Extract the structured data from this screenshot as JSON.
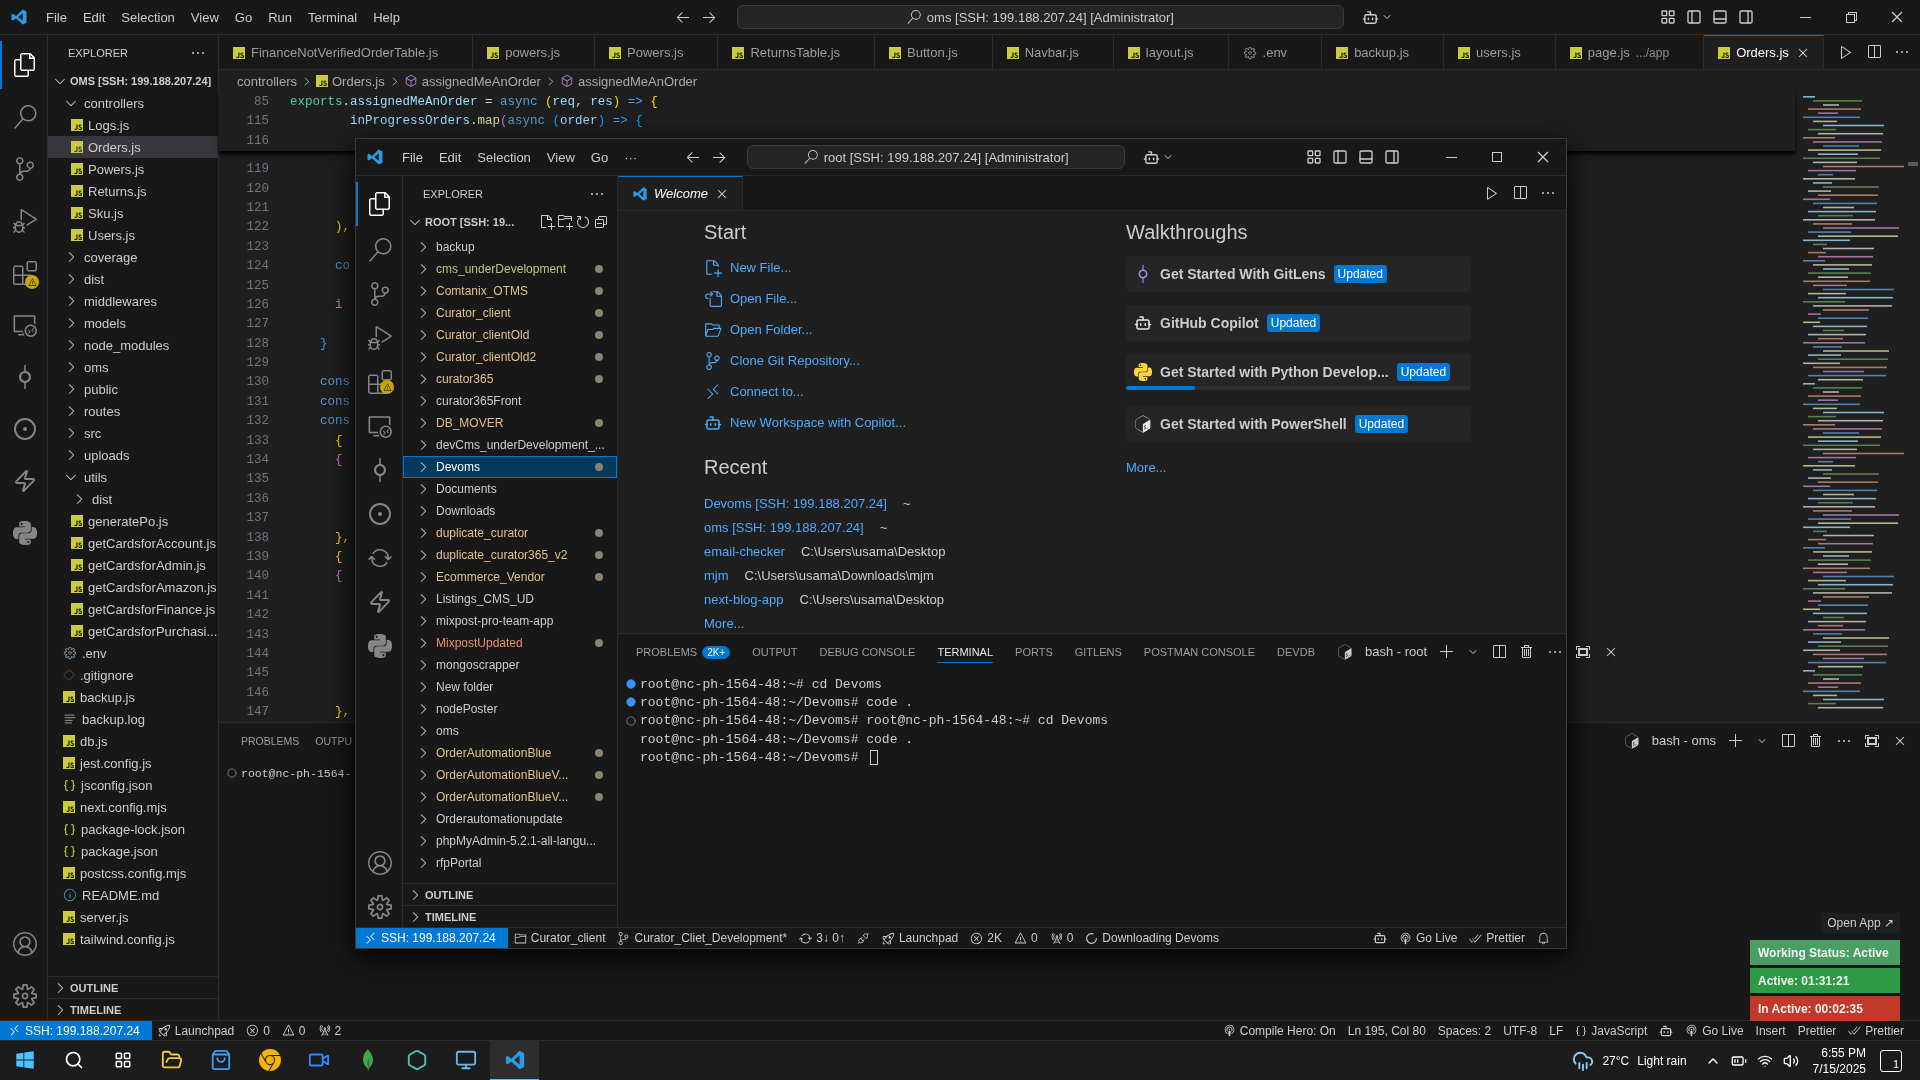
{
  "outer_window": {
    "menu": [
      "File",
      "Edit",
      "Selection",
      "View",
      "Go",
      "Run",
      "Terminal",
      "Help"
    ],
    "command_center": "oms [SSH: 199.188.207.24] [Administrator]",
    "explorer": {
      "title": "EXPLORER",
      "root": "OMS [SSH: 199.188.207.24]",
      "tree": [
        {
          "label": "controllers",
          "kind": "folder",
          "expanded": true,
          "selected": false,
          "children": [
            {
              "label": "Logs.js",
              "kind": "js",
              "selected": false
            },
            {
              "label": "Orders.js",
              "kind": "js",
              "selected": true
            },
            {
              "label": "Powers.js",
              "kind": "js",
              "selected": false
            },
            {
              "label": "Returns.js",
              "kind": "js",
              "selected": false
            },
            {
              "label": "Sku.js",
              "kind": "js",
              "selected": false
            },
            {
              "label": "Users.js",
              "kind": "js",
              "selected": false
            }
          ]
        },
        {
          "label": "coverage",
          "kind": "folder",
          "expanded": false,
          "selected": false
        },
        {
          "label": "dist",
          "kind": "folder",
          "expanded": false,
          "selected": false
        },
        {
          "label": "middlewares",
          "kind": "folder",
          "expanded": false,
          "selected": false
        },
        {
          "label": "models",
          "kind": "folder",
          "expanded": false,
          "selected": false
        },
        {
          "label": "node_modules",
          "kind": "folder",
          "expanded": false,
          "selected": false
        },
        {
          "label": "oms",
          "kind": "folder",
          "expanded": false,
          "selected": false
        },
        {
          "label": "public",
          "kind": "folder",
          "expanded": false,
          "selected": false
        },
        {
          "label": "routes",
          "kind": "folder",
          "expanded": false,
          "selected": false
        },
        {
          "label": "src",
          "kind": "folder",
          "expanded": false,
          "selected": false
        },
        {
          "label": "uploads",
          "kind": "folder",
          "expanded": false,
          "selected": false
        },
        {
          "label": "utils",
          "kind": "folder",
          "expanded": true,
          "selected": false,
          "children": [
            {
              "label": "dist",
              "kind": "folder",
              "expanded": false,
              "selected": false
            },
            {
              "label": "generatePo.js",
              "kind": "js",
              "selected": false
            },
            {
              "label": "getCardsforAccount.js",
              "kind": "js",
              "selected": false
            },
            {
              "label": "getCardsforAdmin.js",
              "kind": "js",
              "selected": false
            },
            {
              "label": "getCardsforAmazon.js",
              "kind": "js",
              "selected": false
            },
            {
              "label": "getCardsforFinance.js",
              "kind": "js",
              "selected": false
            },
            {
              "label": "getCardsforPurchasi...",
              "kind": "js",
              "selected": false
            }
          ]
        },
        {
          "label": ".env",
          "kind": "env",
          "selected": false
        },
        {
          "label": ".gitignore",
          "kind": "git",
          "selected": false
        },
        {
          "label": "backup.js",
          "kind": "js",
          "selected": false
        },
        {
          "label": "backup.log",
          "kind": "log",
          "selected": false
        },
        {
          "label": "db.js",
          "kind": "js",
          "selected": false
        },
        {
          "label": "jest.config.js",
          "kind": "js",
          "selected": false
        },
        {
          "label": "jsconfig.json",
          "kind": "json",
          "selected": false
        },
        {
          "label": "next.config.mjs",
          "kind": "js",
          "selected": false
        },
        {
          "label": "package-lock.json",
          "kind": "json",
          "selected": false
        },
        {
          "label": "package.json",
          "kind": "json",
          "selected": false
        },
        {
          "label": "postcss.config.mjs",
          "kind": "js",
          "selected": false
        },
        {
          "label": "README.md",
          "kind": "info",
          "selected": false
        },
        {
          "label": "server.js",
          "kind": "js",
          "selected": false
        },
        {
          "label": "tailwind.config.js",
          "kind": "js",
          "selected": false
        }
      ],
      "sections": [
        "OUTLINE",
        "TIMELINE"
      ]
    },
    "tabs": [
      {
        "label": "FinanceNotVerifiedOrderTable.js",
        "kind": "js",
        "selected": false
      },
      {
        "label": "powers.js",
        "kind": "js",
        "selected": false
      },
      {
        "label": "Powers.js",
        "kind": "js",
        "selected": false
      },
      {
        "label": "ReturnsTable.js",
        "kind": "js",
        "selected": false
      },
      {
        "label": "Button.js",
        "kind": "js",
        "selected": false
      },
      {
        "label": "Navbar.js",
        "kind": "js",
        "selected": false
      },
      {
        "label": "layout.js",
        "kind": "js",
        "selected": false
      },
      {
        "label": ".env",
        "kind": "env",
        "selected": false
      },
      {
        "label": "backup.js",
        "kind": "js",
        "selected": false
      },
      {
        "label": "users.js",
        "kind": "js",
        "selected": false
      },
      {
        "label": "page.js",
        "detail": ".../app",
        "kind": "js",
        "selected": false
      },
      {
        "label": "Orders.js",
        "kind": "js",
        "selected": true
      }
    ],
    "breadcrumb": [
      {
        "text": "controllers",
        "kind": "folder"
      },
      {
        "text": "Orders.js",
        "kind": "js"
      },
      {
        "text": "assignedMeAnOrder",
        "kind": "symbol"
      },
      {
        "text": "assignedMeAnOrder",
        "kind": "symbol"
      }
    ],
    "sticky_lines": [
      {
        "number": "85",
        "tokens": [
          {
            "text": "exports",
            "kind": "type"
          },
          {
            "text": ".",
            "kind": "plain"
          },
          {
            "text": "assignedMeAnOrder",
            "kind": "variable"
          },
          {
            "text": " = ",
            "kind": "plain"
          },
          {
            "text": "async ",
            "kind": "keyword"
          },
          {
            "text": "(",
            "kind": "bracket1"
          },
          {
            "text": "req",
            "kind": "variable"
          },
          {
            "text": ", ",
            "kind": "plain"
          },
          {
            "text": "res",
            "kind": "variable"
          },
          {
            "text": ")",
            "kind": "bracket1"
          },
          {
            "text": " => ",
            "kind": "keyword"
          },
          {
            "text": "{",
            "kind": "bracket1"
          }
        ]
      },
      {
        "number": "115",
        "tokens": [
          {
            "text": "        inProgressOrders",
            "kind": "variable"
          },
          {
            "text": ".",
            "kind": "plain"
          },
          {
            "text": "map",
            "kind": "function"
          },
          {
            "text": "(",
            "kind": "bracket2"
          },
          {
            "text": "async ",
            "kind": "keyword"
          },
          {
            "text": "(",
            "kind": "bracket3"
          },
          {
            "text": "order",
            "kind": "variable"
          },
          {
            "text": ")",
            "kind": "bracket3"
          },
          {
            "text": " => ",
            "kind": "keyword"
          },
          {
            "text": "{",
            "kind": "bracket3"
          }
        ]
      },
      {
        "number": "116"
      }
    ],
    "code_lines": [
      {
        "number": "119"
      },
      {
        "number": "120"
      },
      {
        "number": "121"
      },
      {
        "number": "122",
        "tokens": [
          {
            "text": "      ),",
            "kind": "bracket1"
          }
        ]
      },
      {
        "number": "123"
      },
      {
        "number": "124",
        "tokens": [
          {
            "text": "      co",
            "kind": "keyword"
          }
        ]
      },
      {
        "number": "125"
      },
      {
        "number": "126",
        "tokens": [
          {
            "text": "      i",
            "kind": "control"
          }
        ]
      },
      {
        "number": "127"
      },
      {
        "number": "128",
        "tokens": [
          {
            "text": "    }",
            "kind": "bracket3"
          }
        ]
      },
      {
        "number": "129"
      },
      {
        "number": "130",
        "tokens": [
          {
            "text": "    cons",
            "kind": "keyword"
          }
        ]
      },
      {
        "number": "131",
        "tokens": [
          {
            "text": "    cons",
            "kind": "keyword"
          }
        ]
      },
      {
        "number": "132",
        "tokens": [
          {
            "text": "    cons",
            "kind": "keyword"
          }
        ]
      },
      {
        "number": "133",
        "tokens": [
          {
            "text": "      {",
            "kind": "bracket1"
          }
        ]
      },
      {
        "number": "134",
        "tokens": [
          {
            "text": "      {",
            "kind": "bracket2"
          }
        ]
      },
      {
        "number": "135"
      },
      {
        "number": "136"
      },
      {
        "number": "137"
      },
      {
        "number": "138",
        "tokens": [
          {
            "text": "      },",
            "kind": "bracket1"
          }
        ]
      },
      {
        "number": "139",
        "tokens": [
          {
            "text": "      {",
            "kind": "bracket1"
          }
        ]
      },
      {
        "number": "140",
        "tokens": [
          {
            "text": "      {",
            "kind": "bracket2"
          }
        ]
      },
      {
        "number": "141"
      },
      {
        "number": "142"
      },
      {
        "number": "143"
      },
      {
        "number": "144"
      },
      {
        "number": "145"
      },
      {
        "number": "146"
      },
      {
        "number": "147",
        "tokens": [
          {
            "text": "      },",
            "kind": "bracket1"
          }
        ]
      }
    ],
    "panel": {
      "tabs": [
        {
          "label": "PROBLEMS",
          "selected": false
        },
        {
          "label": "OUTPU",
          "selected": false
        }
      ],
      "terminal": [
        {
          "text": "root@nc-ph-1564-",
          "kind": "hollow"
        }
      ],
      "terminal_name": "bash - oms"
    },
    "status_bar": {
      "left": [
        {
          "text": "SSH: 199.188.207.24",
          "kind": "remote"
        },
        {
          "text": "Launchpad",
          "kind": "launchpad"
        },
        {
          "text": "0",
          "kind": "errors"
        },
        {
          "text": "0",
          "kind": "warnings"
        },
        {
          "text": "2",
          "kind": "ports"
        }
      ],
      "right": [
        {
          "text": "Compile Hero: On",
          "kind": "broadcast"
        },
        {
          "text": "Ln 195, Col 80",
          "kind": "text"
        },
        {
          "text": "Spaces: 2",
          "kind": "text"
        },
        {
          "text": "UTF-8",
          "kind": "text"
        },
        {
          "text": "LF",
          "kind": "text"
        },
        {
          "text": "JavaScript",
          "kind": "language"
        },
        {
          "kind": "copilot"
        },
        {
          "text": "Go Live",
          "kind": "broadcast"
        },
        {
          "text": "Insert",
          "kind": "text"
        },
        {
          "text": "Prettier",
          "kind": "text"
        },
        {
          "text": "Prettier",
          "kind": "checks"
        }
      ]
    }
  },
  "inner_window": {
    "menu": [
      "File",
      "Edit",
      "Selection",
      "View",
      "Go",
      "···"
    ],
    "command_center": "root [SSH: 199.188.207.24] [Administrator]",
    "explorer": {
      "title": "EXPLORER",
      "root": "ROOT [SSH: 19...",
      "folders": [
        {
          "label": "backup",
          "color": "#cccccc",
          "modified": false,
          "selected": false
        },
        {
          "label": "cms_underDevelopment",
          "color": "#c2c27e",
          "modified": true,
          "selected": false
        },
        {
          "label": "Comtanix_OTMS",
          "color": "#e2c08d",
          "modified": true,
          "selected": false
        },
        {
          "label": "Curator_client",
          "color": "#e2c08d",
          "modified": true,
          "selected": false
        },
        {
          "label": "Curator_clientOld",
          "color": "#e2c08d",
          "modified": true,
          "selected": false
        },
        {
          "label": "Curator_clientOld2",
          "color": "#e2c08d",
          "modified": true,
          "selected": false
        },
        {
          "label": "curator365",
          "color": "#e2c08d",
          "modified": true,
          "selected": false
        },
        {
          "label": "curator365Front",
          "color": "#cccccc",
          "modified": false,
          "selected": false
        },
        {
          "label": "DB_MOVER",
          "color": "#e2c08d",
          "modified": true,
          "selected": false
        },
        {
          "label": "devCms_underDevelopment_...",
          "color": "#cccccc",
          "modified": false,
          "selected": false
        },
        {
          "label": "Devoms",
          "color": "#ffffff",
          "modified": true,
          "selected": true
        },
        {
          "label": "Documents",
          "color": "#cccccc",
          "modified": false,
          "selected": false
        },
        {
          "label": "Downloads",
          "color": "#cccccc",
          "modified": false,
          "selected": false
        },
        {
          "label": "duplicate_curator",
          "color": "#e2c08d",
          "modified": true,
          "selected": false
        },
        {
          "label": "duplicate_curator365_v2",
          "color": "#e2c08d",
          "modified": true,
          "selected": false
        },
        {
          "label": "Ecommerce_Vendor",
          "color": "#e2c08d",
          "modified": true,
          "selected": false
        },
        {
          "label": "Listings_CMS_UD",
          "color": "#cccccc",
          "modified": false,
          "selected": false
        },
        {
          "label": "mixpost-pro-team-app",
          "color": "#cccccc",
          "modified": false,
          "selected": false
        },
        {
          "label": "MixpostUpdated",
          "color": "#e8916d",
          "modified": true,
          "selected": false
        },
        {
          "label": "mongoscrapper",
          "color": "#cccccc",
          "modified": false,
          "selected": false
        },
        {
          "label": "New folder",
          "color": "#cccccc",
          "modified": false,
          "selected": false
        },
        {
          "label": "nodePoster",
          "color": "#cccccc",
          "modified": false,
          "selected": false
        },
        {
          "label": "oms",
          "color": "#cccccc",
          "modified": false,
          "selected": false
        },
        {
          "label": "OrderAutomationBlue",
          "color": "#e2c08d",
          "modified": true,
          "selected": false
        },
        {
          "label": "OrderAutomationBlueV...",
          "color": "#e2c08d",
          "modified": true,
          "selected": false
        },
        {
          "label": "OrderAutomationBlueV...",
          "color": "#e2c08d",
          "modified": true,
          "selected": false
        },
        {
          "label": "Orderautomationupdate",
          "color": "#cccccc",
          "modified": false,
          "selected": false
        },
        {
          "label": "phpMyAdmin-5.2.1-all-langu...",
          "color": "#cccccc",
          "modified": false,
          "selected": false
        },
        {
          "label": "rfpPortal",
          "color": "#cccccc",
          "modified": false,
          "selected": false
        }
      ],
      "sections": [
        "OUTLINE",
        "TIMELINE"
      ]
    },
    "tab": {
      "label": "Welcome"
    },
    "welcome": {
      "start_title": "Start",
      "start": [
        {
          "label": "New File...",
          "kind": "new-file"
        },
        {
          "label": "Open File...",
          "kind": "open-file"
        },
        {
          "label": "Open Folder...",
          "kind": "open-folder"
        },
        {
          "label": "Clone Git Repository...",
          "kind": "clone"
        },
        {
          "label": "Connect to...",
          "kind": "connect"
        },
        {
          "label": "New Workspace with Copilot...",
          "kind": "copilot"
        }
      ],
      "recent_title": "Recent",
      "recent": [
        {
          "name": "Devoms [SSH: 199.188.207.24]",
          "path": "~"
        },
        {
          "name": "oms [SSH: 199.188.207.24]",
          "path": "~"
        },
        {
          "name": "email-checker",
          "path": "C:\\Users\\usama\\Desktop"
        },
        {
          "name": "mjm",
          "path": "C:\\Users\\usama\\Downloads\\mjm"
        },
        {
          "name": "next-blog-app",
          "path": "C:\\Users\\usama\\Desktop"
        }
      ],
      "recent_more": "More...",
      "walkthroughs_title": "Walkthroughs",
      "walkthroughs": [
        {
          "title": "Get Started With GitLens",
          "badge": "Updated",
          "kind": "gitlens"
        },
        {
          "title": "GitHub Copilot",
          "badge": "Updated",
          "kind": "copilot"
        },
        {
          "title": "Get Started with Python Develop...",
          "badge": "Updated",
          "kind": "python",
          "level": 0.2
        },
        {
          "title": "Get Started with PowerShell",
          "badge": "Updated",
          "kind": "powershell"
        }
      ],
      "walkthroughs_more": "More..."
    },
    "panel": {
      "tabs": [
        {
          "label": "PROBLEMS",
          "badge": "2K+",
          "selected": false
        },
        {
          "label": "OUTPUT",
          "selected": false
        },
        {
          "label": "DEBUG CONSOLE",
          "selected": false
        },
        {
          "label": "TERMINAL",
          "selected": true
        },
        {
          "label": "PORTS",
          "selected": false
        },
        {
          "label": "GITLENS",
          "selected": false
        },
        {
          "label": "POSTMAN CONSOLE",
          "selected": false
        },
        {
          "label": "DEVDB",
          "selected": false
        }
      ],
      "terminal_name": "bash - root",
      "terminal": [
        {
          "text": "root@nc-ph-1564-48:~# cd Devoms",
          "kind": "filled"
        },
        {
          "text": "root@nc-ph-1564-48:~/Devoms# code .",
          "kind": "filled"
        },
        {
          "text": "root@nc-ph-1564-48:~/Devoms# root@nc-ph-1564-48:~# cd Devoms",
          "kind": "hollow"
        },
        {
          "text": "root@nc-ph-1564-48:~/Devoms# code .",
          "kind": "none"
        },
        {
          "text": "root@nc-ph-1564-48:~/Devoms#",
          "kind": "none",
          "cursor": true
        }
      ]
    },
    "status_bar": {
      "left": [
        {
          "text": "SSH: 199.188.207.24",
          "kind": "remote"
        },
        {
          "text": "Curator_client",
          "kind": "folder"
        },
        {
          "text": "Curator_Cliet_Development*",
          "kind": "branch"
        },
        {
          "text": "3↓ 0↑",
          "kind": "sync"
        },
        {
          "kind": "accounts"
        },
        {
          "text": "Launchpad",
          "kind": "launchpad"
        },
        {
          "text": "2K",
          "kind": "errors"
        },
        {
          "text": "0",
          "kind": "warnings"
        },
        {
          "text": "0",
          "kind": "ports"
        },
        {
          "text": "Downloading Devoms",
          "kind": "loading"
        }
      ],
      "right": [
        {
          "kind": "copilot"
        },
        {
          "text": "Go Live",
          "kind": "broadcast"
        },
        {
          "text": "Prettier",
          "kind": "checks"
        },
        {
          "kind": "bell"
        }
      ]
    }
  },
  "time_tracker": {
    "open_app": "Open App ↗",
    "rows": [
      {
        "text": "Working Status: Active",
        "color": "#4b9e62"
      },
      {
        "text": "Active: 01:31:21",
        "color": "#2f9a45"
      },
      {
        "text": "In Active: 00:02:35",
        "color": "#c0392b"
      }
    ]
  },
  "taskbar": {
    "apps": [
      {
        "kind": "files",
        "selected": false
      },
      {
        "kind": "store",
        "selected": false
      },
      {
        "kind": "chrome",
        "selected": false
      },
      {
        "kind": "zoom",
        "selected": false
      },
      {
        "kind": "mongodb",
        "selected": false
      },
      {
        "kind": "hexagon",
        "selected": false
      },
      {
        "kind": "monitor",
        "selected": false
      },
      {
        "kind": "vscode",
        "selected": true
      }
    ],
    "temperature": "27°C",
    "weather": "Light rain",
    "time": "6:55 PM",
    "date": "7/15/2025",
    "notifications": "1"
  }
}
